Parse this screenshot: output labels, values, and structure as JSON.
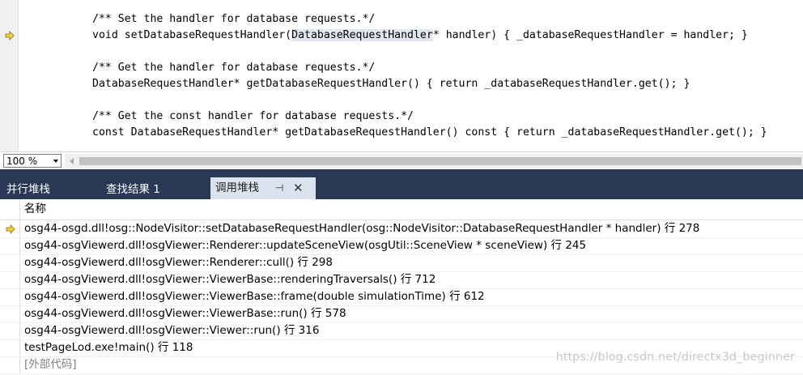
{
  "editor": {
    "code_lines": [
      "/** Set the handler for database requests.*/",
      "void setDatabaseRequestHandler(",
      "/** Get the handler for database requests.*/",
      "DatabaseRequestHandler* getDatabaseRequestHandler() { return _databaseRequestHandler.get(); }",
      "/** Get the const handler for database requests.*/",
      "const DatabaseRequestHandler* getDatabaseRequestHandler() const { return _databaseRequestHandler.get(); }"
    ],
    "highlighted_token": "DatabaseRequestHandler",
    "line2_rest": "* handler) { _databaseRequestHandler = handler; }",
    "zoom": "100 %"
  },
  "tabs": [
    {
      "label": "并行堆栈"
    },
    {
      "label": "查找结果 1"
    },
    {
      "label": "调用堆栈",
      "pin": "⊣",
      "close": "✕"
    }
  ],
  "callstack": {
    "column_header": "名称",
    "rows": [
      "osg44-osgd.dll!osg::NodeVisitor::setDatabaseRequestHandler(osg::NodeVisitor::DatabaseRequestHandler * handler) 行 278",
      "osg44-osgViewerd.dll!osgViewer::Renderer::updateSceneView(osgUtil::SceneView * sceneView) 行 245",
      "osg44-osgViewerd.dll!osgViewer::Renderer::cull() 行 298",
      "osg44-osgViewerd.dll!osgViewer::ViewerBase::renderingTraversals() 行 712",
      "osg44-osgViewerd.dll!osgViewer::ViewerBase::frame(double simulationTime) 行 612",
      "osg44-osgViewerd.dll!osgViewer::ViewerBase::run() 行 578",
      "osg44-osgViewerd.dll!osgViewer::Viewer::run() 行 316",
      "testPageLod.exe!main() 行 118",
      "[外部代码]"
    ]
  },
  "watermark": "https://blog.csdn.net/directx3d_beginner",
  "colors": {
    "tab_bg": "#293955",
    "active_tab": "#dbe3ee",
    "arrow": "#f7d23e"
  }
}
